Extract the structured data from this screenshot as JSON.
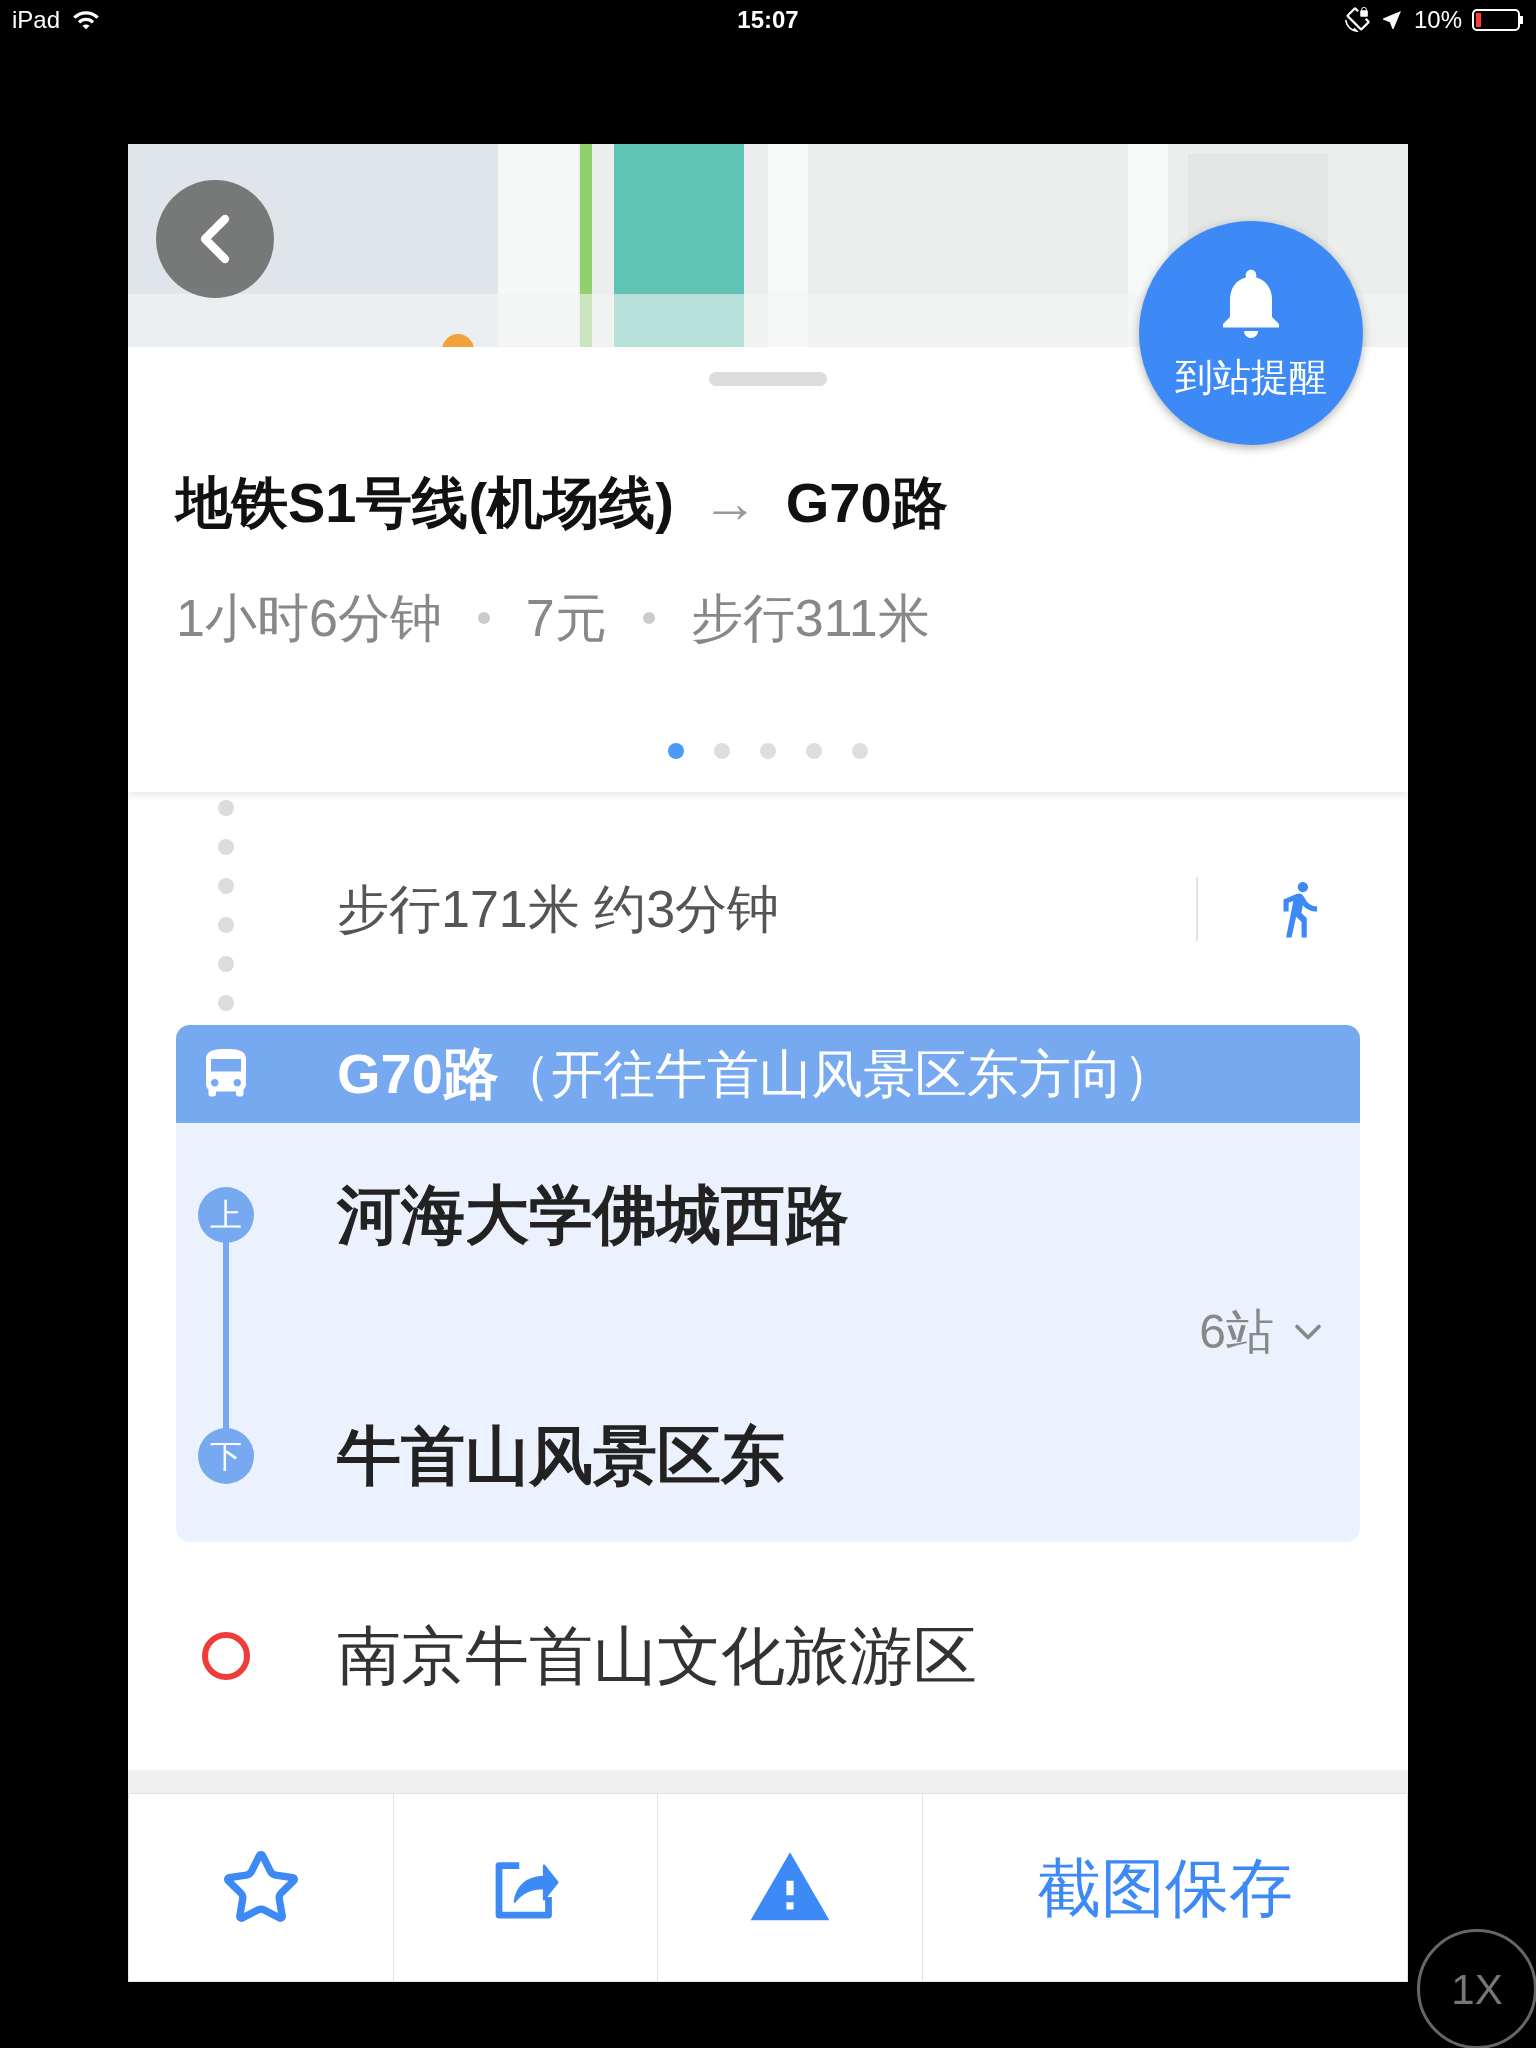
{
  "status_bar": {
    "device": "iPad",
    "time": "15:07",
    "battery": "10%"
  },
  "alert_button": {
    "label": "到站提醒"
  },
  "route": {
    "from": "地铁S1号线(机场线)",
    "arrow": "→",
    "to": "G70路",
    "duration": "1小时6分钟",
    "fare": "7元",
    "walk": "步行311米"
  },
  "pager": [
    {
      "selected": true
    },
    {
      "selected": false
    },
    {
      "selected": false
    },
    {
      "selected": false
    },
    {
      "selected": false
    }
  ],
  "steps": [
    {
      "kind": "walk",
      "text": "步行171米 约3分钟"
    },
    {
      "kind": "bus",
      "line": "G70路",
      "direction": "（开往牛首山风景区东方向）",
      "board_badge": "上",
      "board_stop": "河海大学佛城西路",
      "stops": "6站",
      "expanded": false,
      "alight_badge": "下",
      "alight_stop": "牛首山风景区东"
    },
    {
      "kind": "destination",
      "text": "南京牛首山文化旅游区"
    }
  ],
  "toolbar": [
    {
      "kind": "favorite"
    },
    {
      "kind": "share"
    },
    {
      "kind": "report"
    },
    {
      "kind": "text",
      "label": "截图保存"
    }
  ],
  "zoom_button": {
    "label": "1X"
  }
}
